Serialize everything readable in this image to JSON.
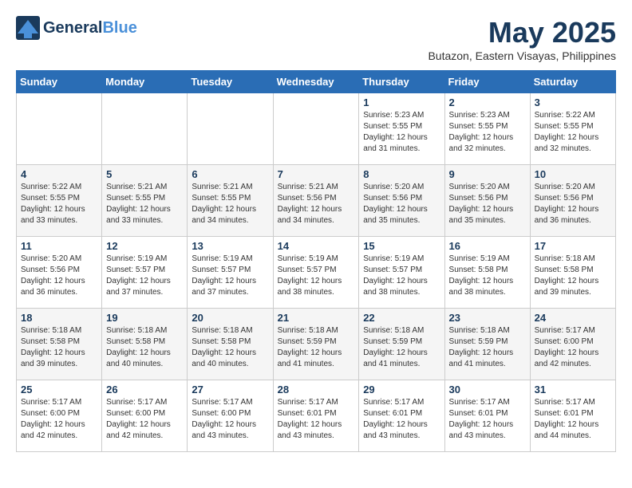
{
  "header": {
    "logo_general": "General",
    "logo_blue": "Blue",
    "month_title": "May 2025",
    "location": "Butazon, Eastern Visayas, Philippines"
  },
  "days_of_week": [
    "Sunday",
    "Monday",
    "Tuesday",
    "Wednesday",
    "Thursday",
    "Friday",
    "Saturday"
  ],
  "weeks": [
    [
      {
        "day": "",
        "info": ""
      },
      {
        "day": "",
        "info": ""
      },
      {
        "day": "",
        "info": ""
      },
      {
        "day": "",
        "info": ""
      },
      {
        "day": "1",
        "info": "Sunrise: 5:23 AM\nSunset: 5:55 PM\nDaylight: 12 hours\nand 31 minutes."
      },
      {
        "day": "2",
        "info": "Sunrise: 5:23 AM\nSunset: 5:55 PM\nDaylight: 12 hours\nand 32 minutes."
      },
      {
        "day": "3",
        "info": "Sunrise: 5:22 AM\nSunset: 5:55 PM\nDaylight: 12 hours\nand 32 minutes."
      }
    ],
    [
      {
        "day": "4",
        "info": "Sunrise: 5:22 AM\nSunset: 5:55 PM\nDaylight: 12 hours\nand 33 minutes."
      },
      {
        "day": "5",
        "info": "Sunrise: 5:21 AM\nSunset: 5:55 PM\nDaylight: 12 hours\nand 33 minutes."
      },
      {
        "day": "6",
        "info": "Sunrise: 5:21 AM\nSunset: 5:55 PM\nDaylight: 12 hours\nand 34 minutes."
      },
      {
        "day": "7",
        "info": "Sunrise: 5:21 AM\nSunset: 5:56 PM\nDaylight: 12 hours\nand 34 minutes."
      },
      {
        "day": "8",
        "info": "Sunrise: 5:20 AM\nSunset: 5:56 PM\nDaylight: 12 hours\nand 35 minutes."
      },
      {
        "day": "9",
        "info": "Sunrise: 5:20 AM\nSunset: 5:56 PM\nDaylight: 12 hours\nand 35 minutes."
      },
      {
        "day": "10",
        "info": "Sunrise: 5:20 AM\nSunset: 5:56 PM\nDaylight: 12 hours\nand 36 minutes."
      }
    ],
    [
      {
        "day": "11",
        "info": "Sunrise: 5:20 AM\nSunset: 5:56 PM\nDaylight: 12 hours\nand 36 minutes."
      },
      {
        "day": "12",
        "info": "Sunrise: 5:19 AM\nSunset: 5:57 PM\nDaylight: 12 hours\nand 37 minutes."
      },
      {
        "day": "13",
        "info": "Sunrise: 5:19 AM\nSunset: 5:57 PM\nDaylight: 12 hours\nand 37 minutes."
      },
      {
        "day": "14",
        "info": "Sunrise: 5:19 AM\nSunset: 5:57 PM\nDaylight: 12 hours\nand 38 minutes."
      },
      {
        "day": "15",
        "info": "Sunrise: 5:19 AM\nSunset: 5:57 PM\nDaylight: 12 hours\nand 38 minutes."
      },
      {
        "day": "16",
        "info": "Sunrise: 5:19 AM\nSunset: 5:58 PM\nDaylight: 12 hours\nand 38 minutes."
      },
      {
        "day": "17",
        "info": "Sunrise: 5:18 AM\nSunset: 5:58 PM\nDaylight: 12 hours\nand 39 minutes."
      }
    ],
    [
      {
        "day": "18",
        "info": "Sunrise: 5:18 AM\nSunset: 5:58 PM\nDaylight: 12 hours\nand 39 minutes."
      },
      {
        "day": "19",
        "info": "Sunrise: 5:18 AM\nSunset: 5:58 PM\nDaylight: 12 hours\nand 40 minutes."
      },
      {
        "day": "20",
        "info": "Sunrise: 5:18 AM\nSunset: 5:58 PM\nDaylight: 12 hours\nand 40 minutes."
      },
      {
        "day": "21",
        "info": "Sunrise: 5:18 AM\nSunset: 5:59 PM\nDaylight: 12 hours\nand 41 minutes."
      },
      {
        "day": "22",
        "info": "Sunrise: 5:18 AM\nSunset: 5:59 PM\nDaylight: 12 hours\nand 41 minutes."
      },
      {
        "day": "23",
        "info": "Sunrise: 5:18 AM\nSunset: 5:59 PM\nDaylight: 12 hours\nand 41 minutes."
      },
      {
        "day": "24",
        "info": "Sunrise: 5:17 AM\nSunset: 6:00 PM\nDaylight: 12 hours\nand 42 minutes."
      }
    ],
    [
      {
        "day": "25",
        "info": "Sunrise: 5:17 AM\nSunset: 6:00 PM\nDaylight: 12 hours\nand 42 minutes."
      },
      {
        "day": "26",
        "info": "Sunrise: 5:17 AM\nSunset: 6:00 PM\nDaylight: 12 hours\nand 42 minutes."
      },
      {
        "day": "27",
        "info": "Sunrise: 5:17 AM\nSunset: 6:00 PM\nDaylight: 12 hours\nand 43 minutes."
      },
      {
        "day": "28",
        "info": "Sunrise: 5:17 AM\nSunset: 6:01 PM\nDaylight: 12 hours\nand 43 minutes."
      },
      {
        "day": "29",
        "info": "Sunrise: 5:17 AM\nSunset: 6:01 PM\nDaylight: 12 hours\nand 43 minutes."
      },
      {
        "day": "30",
        "info": "Sunrise: 5:17 AM\nSunset: 6:01 PM\nDaylight: 12 hours\nand 43 minutes."
      },
      {
        "day": "31",
        "info": "Sunrise: 5:17 AM\nSunset: 6:01 PM\nDaylight: 12 hours\nand 44 minutes."
      }
    ]
  ]
}
